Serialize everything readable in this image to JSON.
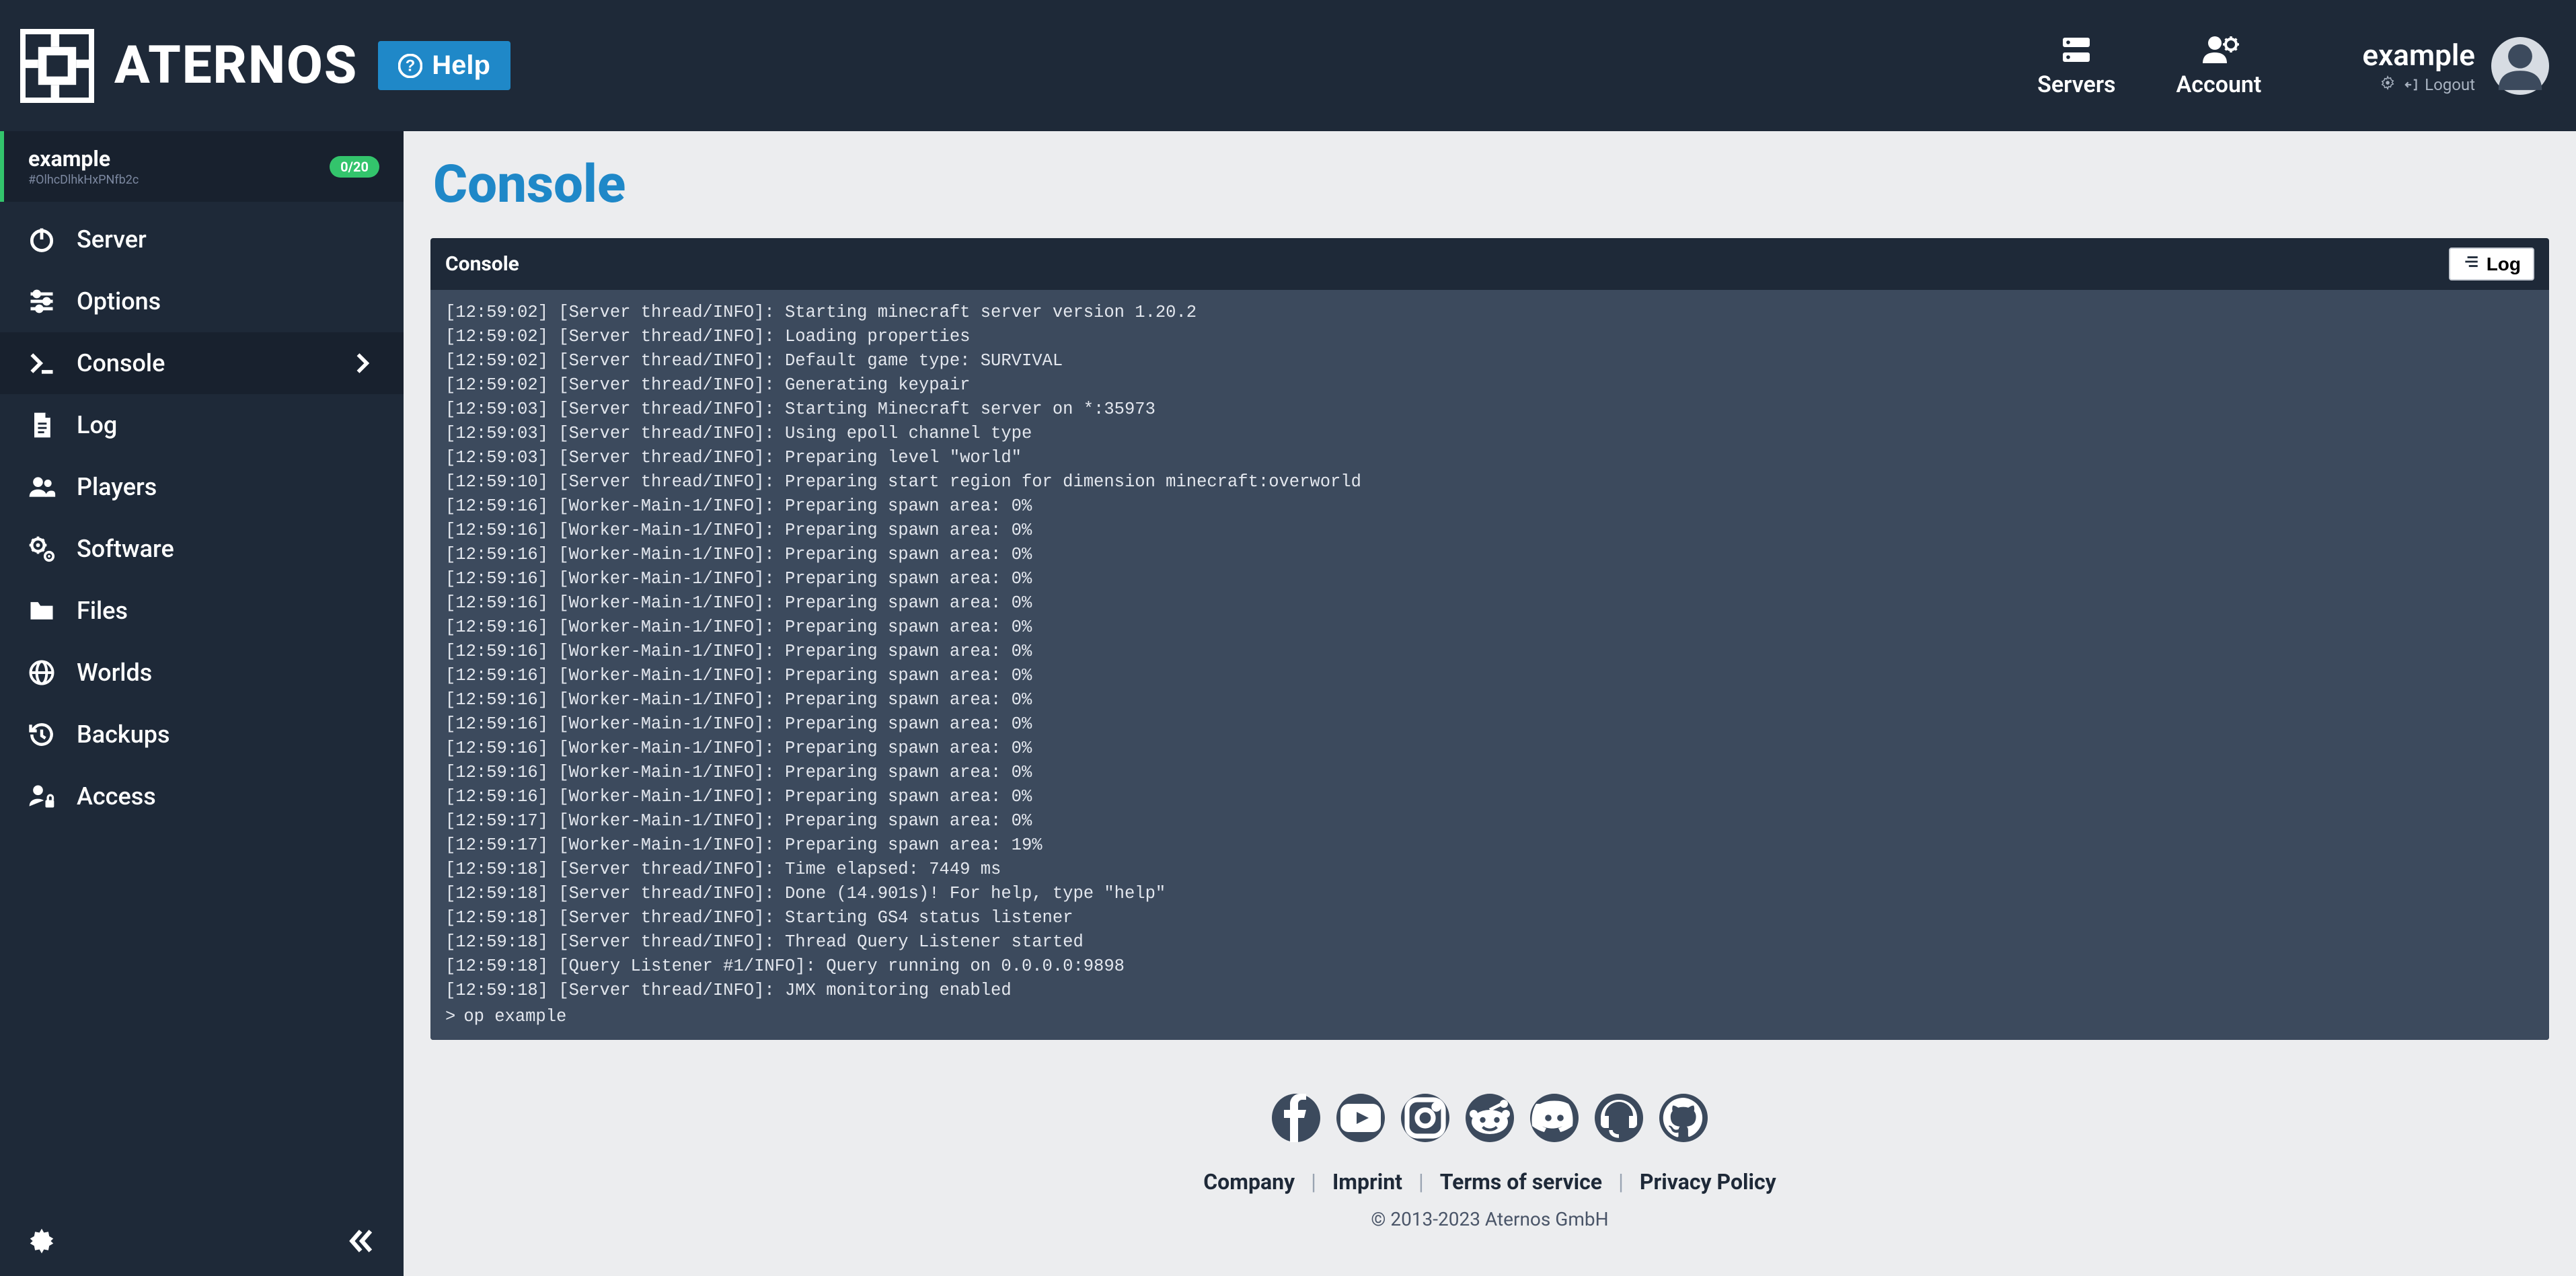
{
  "brand": "ATERNOS",
  "help_label": "Help",
  "header_nav": {
    "servers": "Servers",
    "account": "Account"
  },
  "user": {
    "name": "example",
    "logout": "Logout"
  },
  "server_card": {
    "name": "example",
    "id": "#OlhcDlhkHxPNfb2c",
    "badge": "0/20"
  },
  "sidebar": {
    "items": [
      {
        "label": "Server"
      },
      {
        "label": "Options"
      },
      {
        "label": "Console"
      },
      {
        "label": "Log"
      },
      {
        "label": "Players"
      },
      {
        "label": "Software"
      },
      {
        "label": "Files"
      },
      {
        "label": "Worlds"
      },
      {
        "label": "Backups"
      },
      {
        "label": "Access"
      }
    ]
  },
  "page": {
    "title": "Console",
    "console_label": "Console",
    "log_button": "Log"
  },
  "console_input": "op example",
  "console_lines": [
    "[12:59:02] [Server thread/INFO]: Starting minecraft server version 1.20.2",
    "[12:59:02] [Server thread/INFO]: Loading properties",
    "[12:59:02] [Server thread/INFO]: Default game type: SURVIVAL",
    "[12:59:02] [Server thread/INFO]: Generating keypair",
    "[12:59:03] [Server thread/INFO]: Starting Minecraft server on *:35973",
    "[12:59:03] [Server thread/INFO]: Using epoll channel type",
    "[12:59:03] [Server thread/INFO]: Preparing level \"world\"",
    "[12:59:10] [Server thread/INFO]: Preparing start region for dimension minecraft:overworld",
    "[12:59:16] [Worker-Main-1/INFO]: Preparing spawn area: 0%",
    "[12:59:16] [Worker-Main-1/INFO]: Preparing spawn area: 0%",
    "[12:59:16] [Worker-Main-1/INFO]: Preparing spawn area: 0%",
    "[12:59:16] [Worker-Main-1/INFO]: Preparing spawn area: 0%",
    "[12:59:16] [Worker-Main-1/INFO]: Preparing spawn area: 0%",
    "[12:59:16] [Worker-Main-1/INFO]: Preparing spawn area: 0%",
    "[12:59:16] [Worker-Main-1/INFO]: Preparing spawn area: 0%",
    "[12:59:16] [Worker-Main-1/INFO]: Preparing spawn area: 0%",
    "[12:59:16] [Worker-Main-1/INFO]: Preparing spawn area: 0%",
    "[12:59:16] [Worker-Main-1/INFO]: Preparing spawn area: 0%",
    "[12:59:16] [Worker-Main-1/INFO]: Preparing spawn area: 0%",
    "[12:59:16] [Worker-Main-1/INFO]: Preparing spawn area: 0%",
    "[12:59:16] [Worker-Main-1/INFO]: Preparing spawn area: 0%",
    "[12:59:17] [Worker-Main-1/INFO]: Preparing spawn area: 0%",
    "[12:59:17] [Worker-Main-1/INFO]: Preparing spawn area: 19%",
    "[12:59:18] [Server thread/INFO]: Time elapsed: 7449 ms",
    "[12:59:18] [Server thread/INFO]: Done (14.901s)! For help, type \"help\"",
    "[12:59:18] [Server thread/INFO]: Starting GS4 status listener",
    "[12:59:18] [Server thread/INFO]: Thread Query Listener started",
    "[12:59:18] [Query Listener #1/INFO]: Query running on 0.0.0.0:9898",
    "[12:59:18] [Server thread/INFO]: JMX monitoring enabled"
  ],
  "footer": {
    "links": {
      "company": "Company",
      "imprint": "Imprint",
      "tos": "Terms of service",
      "privacy": "Privacy Policy"
    },
    "copyright": "© 2013-2023 Aternos GmbH"
  }
}
